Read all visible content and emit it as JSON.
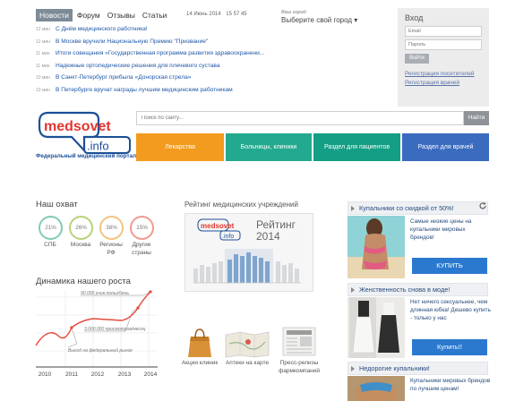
{
  "nav_tabs": [
    {
      "label": "Новости",
      "active": true
    },
    {
      "label": "Форум",
      "active": false
    },
    {
      "label": "Отзывы",
      "active": false
    },
    {
      "label": "Статьи",
      "active": false
    }
  ],
  "datetime": {
    "date": "14 Июнь 2014",
    "clock": "15  57  45"
  },
  "city": {
    "caption": "Ваш город",
    "select_label": "Выберите свой город ▾"
  },
  "news": [
    {
      "time": "12 мин",
      "title": "С Днём медицинского работника!"
    },
    {
      "time": "12 мин",
      "title": "В Москве вручили Национальную Премию \"Призвание\""
    },
    {
      "time": "11 мин",
      "title": "Итоги совещания «Государственная программа развития здравоохранени..."
    },
    {
      "time": "11 мин",
      "title": "Надежные ортопедические решения для плечевого сустава"
    },
    {
      "time": "10 мин",
      "title": "В Санкт-Петербург прибыла «Донорская стрела»"
    },
    {
      "time": "10 мин",
      "title": "В Петербурге вручат награды лучшим медицинским работникам"
    }
  ],
  "login": {
    "title": "Вход",
    "email_placeholder": "Email",
    "password_placeholder": "Пароль",
    "button": "Войти",
    "register_visitors": "Регистрация посетителей",
    "register_doctors": "Регистрация врачей"
  },
  "logo": {
    "main": "medsovet",
    "sub": ".info",
    "tagline": "Федеральный медицинский портал"
  },
  "search": {
    "placeholder": "Поиск по сайту...",
    "button": "Найти"
  },
  "tiles": [
    {
      "label": "Лекарства",
      "color": "#f39b1e"
    },
    {
      "label": "Больницы, клиники",
      "color": "#23a98f"
    },
    {
      "label": "Раздел для пациентов",
      "color": "#139e85"
    },
    {
      "label": "Раздел для врачей",
      "color": "#3a6bbf"
    }
  ],
  "coverage": {
    "title": "Наш охват",
    "items": [
      {
        "value": "21%",
        "label": "СПБ",
        "color": "#7fcbb5",
        "fraction": 0.21
      },
      {
        "value": "26%",
        "label": "Москва",
        "color": "#b8d27a",
        "fraction": 0.26
      },
      {
        "value": "38%",
        "label": "Регионы РФ",
        "color": "#f3c37e",
        "fraction": 0.38
      },
      {
        "value": "15%",
        "label": "Другие страны",
        "color": "#ef9a8f",
        "fraction": 0.15
      }
    ]
  },
  "growth": {
    "title": "Динамика нашего роста",
    "annotations": [
      "90.000 уник.польз/день",
      "3.000.000 просмотров/месяц",
      "Выход на федеральный рынок"
    ],
    "chart_data": {
      "type": "line",
      "categories": [
        "2010",
        "2011",
        "2012",
        "2013",
        "2014"
      ],
      "color": "#e6483c"
    }
  },
  "rating": {
    "title": "Рейтинг медицинских учреждений",
    "label_line1": "Рейтинг",
    "label_line2": "2014",
    "logo_main": "medsovet",
    "logo_sub": ".info"
  },
  "icons": [
    {
      "name": "Акции клиник",
      "icon": "shopping-bag-icon"
    },
    {
      "name": "Аптеки на карте",
      "icon": "map-icon"
    },
    {
      "name": "Пресс-релизы фармкомпаний",
      "icon": "press-release-icon"
    }
  ],
  "ads": [
    {
      "title": "Купальники со скидкой от 50%!",
      "text": "Самые низкие цены на купальники мировых брендов!",
      "button": "КУПИТЬ"
    },
    {
      "title": "Женственность снова в моде!",
      "text": "Нет ничего сексуальнее, чем длинная юбка! Дешево купить - только у нас",
      "button": "Купить!!"
    },
    {
      "title": "Недорогие купальники!",
      "text": "Купальники мировых брендов по лучшим ценам!",
      "button": ""
    }
  ]
}
